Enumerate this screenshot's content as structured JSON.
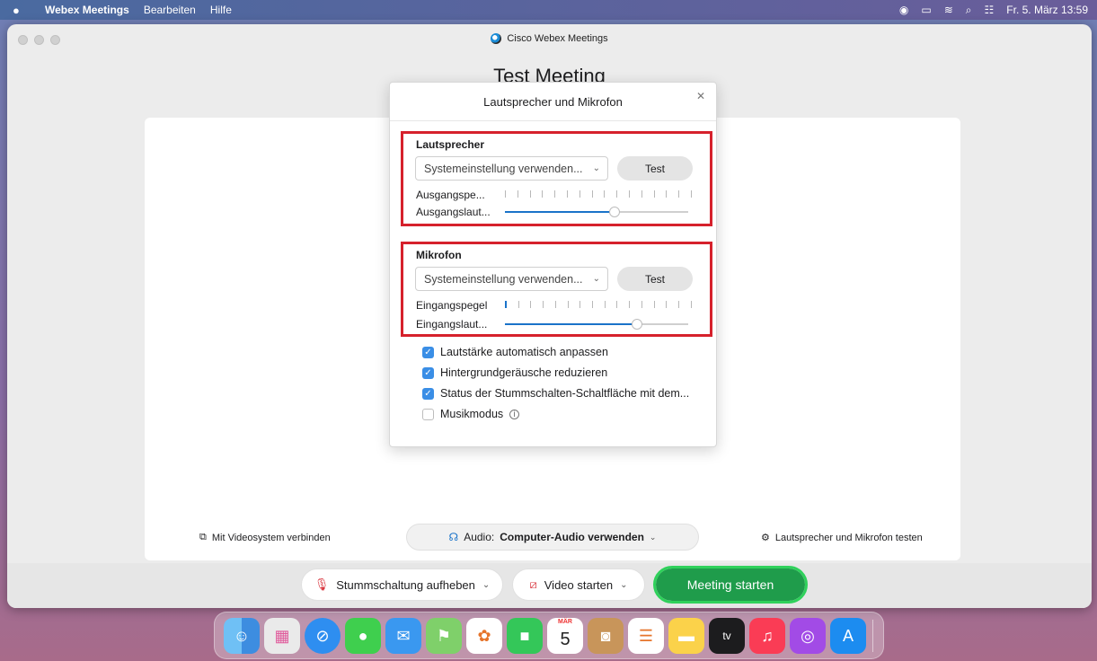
{
  "menubar": {
    "app_name": "Webex Meetings",
    "menus": [
      "Bearbeiten",
      "Hilfe"
    ],
    "datetime": "Fr. 5. März 13:59"
  },
  "window": {
    "title": "Cisco Webex Meetings",
    "meeting_title": "Test Meeting"
  },
  "bottom": {
    "video_system_label": "Mit Videosystem verbinden",
    "audio_prefix": "Audio:",
    "audio_value": "Computer-Audio verwenden",
    "test_audio_label": "Lautsprecher und Mikrofon testen",
    "unmute_label": "Stummschaltung aufheben",
    "video_label": "Video starten",
    "start_label": "Meeting starten"
  },
  "modal": {
    "title": "Lautsprecher und Mikrofon",
    "speaker": {
      "heading": "Lautsprecher",
      "select_value": "Systemeinstellung verwenden...",
      "test_label": "Test",
      "level_label": "Ausgangspe...",
      "volume_label": "Ausgangslaut...",
      "level_active_bars": 0,
      "volume_fraction": 0.6
    },
    "mic": {
      "heading": "Mikrofon",
      "select_value": "Systemeinstellung verwenden...",
      "test_label": "Test",
      "level_label": "Eingangspegel",
      "volume_label": "Eingangslaut...",
      "level_active_bars": 1,
      "volume_fraction": 0.72
    },
    "options": [
      {
        "label": "Lautstärke automatisch anpassen",
        "checked": true
      },
      {
        "label": "Hintergrundgeräusche reduzieren",
        "checked": true
      },
      {
        "label": "Status der Stummschalten-Schaltfläche mit dem...",
        "checked": true
      },
      {
        "label": "Musikmodus",
        "checked": false
      }
    ]
  },
  "dock": {
    "calendar_month": "MÄR",
    "calendar_day": "5",
    "tv_label": "tv"
  },
  "colors": {
    "highlight_red": "#d6212c",
    "start_green": "#1f9c4b",
    "accent_blue": "#1a73c9"
  }
}
